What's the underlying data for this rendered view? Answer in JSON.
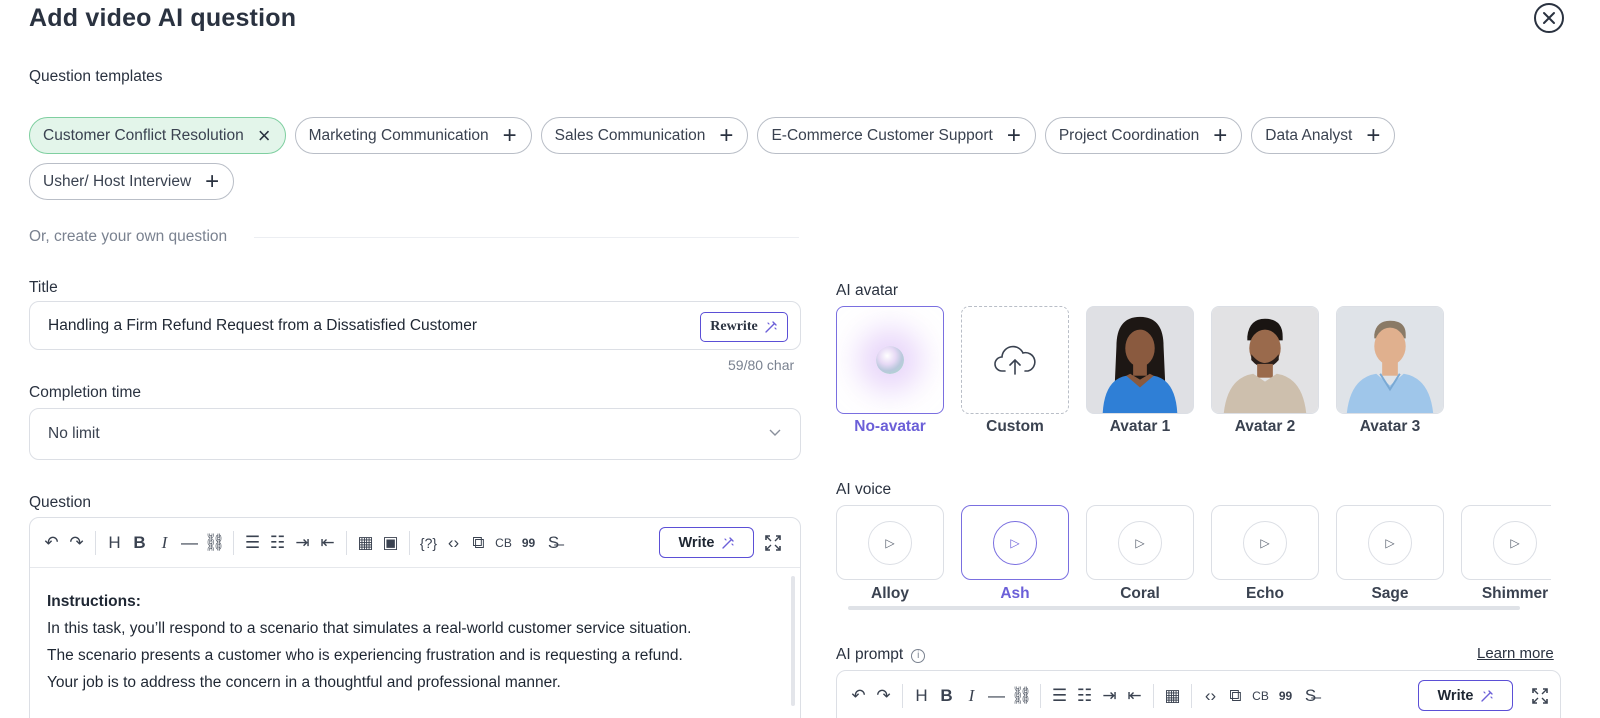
{
  "header": {
    "title": "Add video AI question",
    "close_icon": "×"
  },
  "templates": {
    "label": "Question templates",
    "items": [
      {
        "label": "Customer Conflict Resolution",
        "selected": true,
        "icon": "×"
      },
      {
        "label": "Marketing Communication",
        "selected": false,
        "icon": "+"
      },
      {
        "label": "Sales Communication",
        "selected": false,
        "icon": "+"
      },
      {
        "label": "E-Commerce Customer Support",
        "selected": false,
        "icon": "+"
      },
      {
        "label": "Project Coordination",
        "selected": false,
        "icon": "+"
      },
      {
        "label": "Data Analyst",
        "selected": false,
        "icon": "+"
      },
      {
        "label": "Usher/ Host Interview",
        "selected": false,
        "icon": "+"
      }
    ]
  },
  "own_question": {
    "label": "Or, create your own question"
  },
  "title_field": {
    "label": "Title",
    "value": "Handling a Firm Refund Request from a Dissatisfied Customer",
    "rewrite_label": "Rewrite",
    "char_count": "59/80 char"
  },
  "completion_time": {
    "label": "Completion time",
    "value": "No limit"
  },
  "question": {
    "label": "Question",
    "write_label": "Write",
    "toolbar": {
      "undo": "↶",
      "redo": "↷",
      "heading": "H",
      "bold": "B",
      "italic": "I",
      "hr": "—",
      "link": "⛓",
      "ordered_list": "☰",
      "bullet_list": "☷",
      "indent": "⇥",
      "outdent": "⇤",
      "table": "▦",
      "image": "▣",
      "variable": "{?}",
      "code": "‹›",
      "copy": "⧉",
      "codeblock": "CB",
      "quote": "99",
      "strike": "S̶"
    },
    "body": {
      "heading": "Instructions:",
      "lines": [
        "In this task, you’ll respond to a scenario that simulates a real-world customer service situation.",
        "The scenario presents a customer who is experiencing frustration and is requesting a refund.",
        "Your job is to address the concern in a thoughtful and professional manner."
      ]
    }
  },
  "ai_avatar": {
    "label": "AI avatar",
    "items": [
      {
        "name": "No-avatar",
        "selected": true
      },
      {
        "name": "Custom",
        "selected": false
      },
      {
        "name": "Avatar 1",
        "selected": false
      },
      {
        "name": "Avatar 2",
        "selected": false
      },
      {
        "name": "Avatar 3",
        "selected": false
      }
    ]
  },
  "ai_voice": {
    "label": "AI voice",
    "items": [
      {
        "name": "Alloy",
        "selected": false
      },
      {
        "name": "Ash",
        "selected": true
      },
      {
        "name": "Coral",
        "selected": false
      },
      {
        "name": "Echo",
        "selected": false
      },
      {
        "name": "Sage",
        "selected": false
      },
      {
        "name": "Shimmer",
        "selected": false
      }
    ]
  },
  "ai_prompt": {
    "label": "AI prompt",
    "learn_more": "Learn more",
    "write_label": "Write"
  },
  "colors": {
    "accent": "#5b4fd6",
    "selected_chip_bg": "#e3f5ea",
    "selected_chip_border": "#7fcfa0"
  }
}
